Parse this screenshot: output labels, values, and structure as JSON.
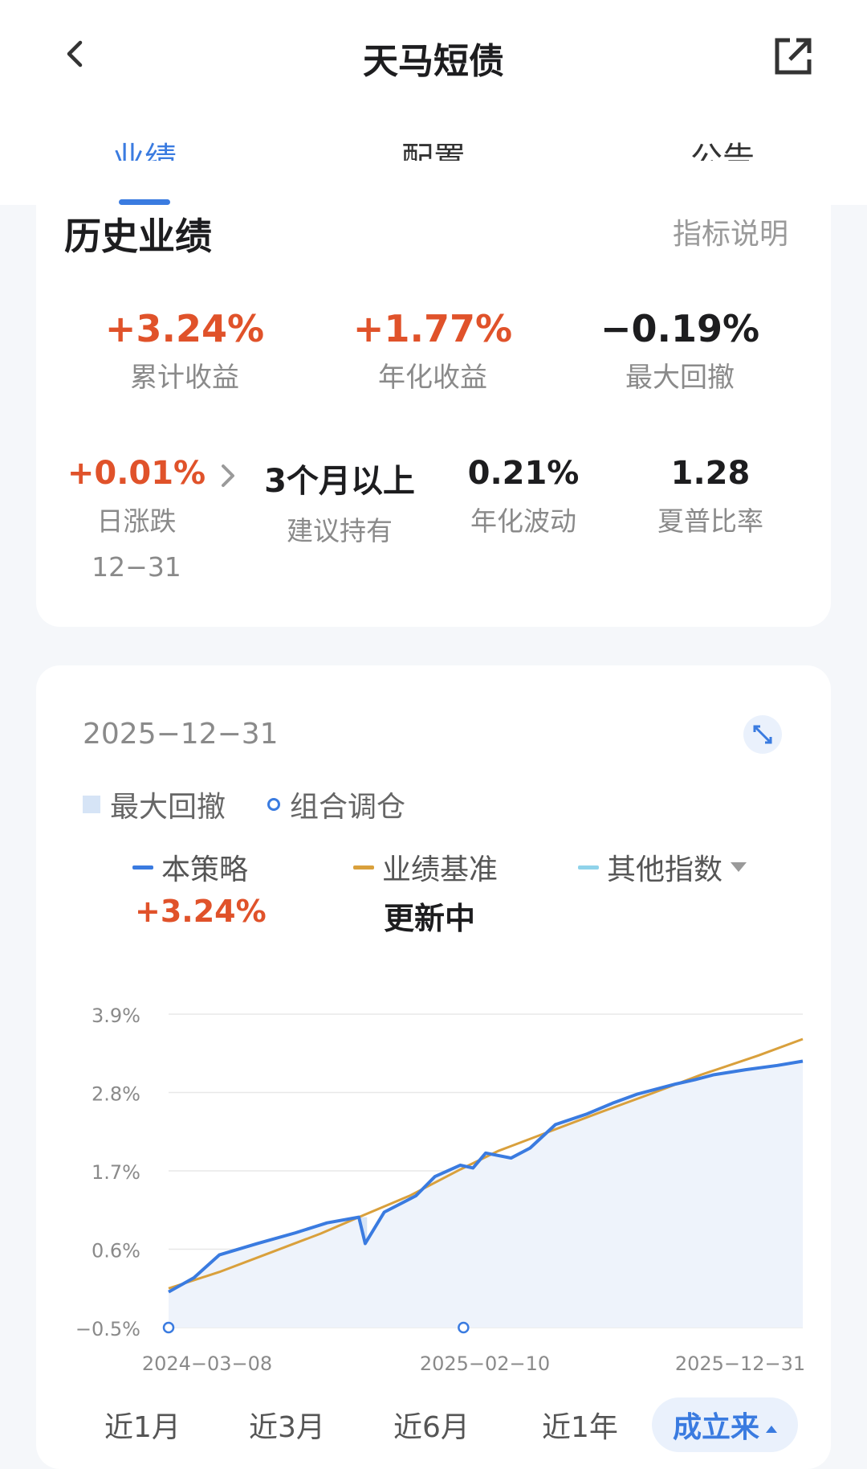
{
  "header": {
    "title": "天马短债"
  },
  "tabs": [
    {
      "label": "业绩",
      "active": true
    },
    {
      "label": "配置",
      "active": false
    },
    {
      "label": "公告",
      "active": false
    }
  ],
  "history": {
    "title": "历史业绩",
    "link": "指标说明",
    "metrics_top": [
      {
        "value": "+3.24%",
        "label": "累计收益",
        "color": "red"
      },
      {
        "value": "+1.77%",
        "label": "年化收益",
        "color": "red"
      },
      {
        "value": "−0.19%",
        "label": "最大回撤",
        "color": "dark"
      }
    ],
    "daily": {
      "value": "+0.01%",
      "label": "日涨跌",
      "date": "12−31"
    },
    "metrics_bottom": [
      {
        "value": "3个月以上",
        "label": "建议持有"
      },
      {
        "value": "0.21%",
        "label": "年化波动"
      },
      {
        "value": "1.28",
        "label": "夏普比率"
      }
    ]
  },
  "chart_panel": {
    "date": "2025−12−31",
    "legend_drawdown": "最大回撤",
    "legend_rebalance": "组合调仓",
    "series_legend": [
      {
        "name": "本策略",
        "color": "#3a7be0",
        "value": "+3.24%"
      },
      {
        "name": "业绩基准",
        "color": "#d9a03c",
        "value": "更新中"
      },
      {
        "name": "其他指数",
        "color": "#8fd3ea",
        "value": ""
      }
    ],
    "range_tabs": [
      {
        "label": "近1月",
        "active": false
      },
      {
        "label": "近3月",
        "active": false
      },
      {
        "label": "近6月",
        "active": false
      },
      {
        "label": "近1年",
        "active": false
      },
      {
        "label": "成立来",
        "active": true
      }
    ]
  },
  "chart_data": {
    "type": "line",
    "y_ticks": [
      "3.9%",
      "2.8%",
      "1.7%",
      "0.6%",
      "−0.5%"
    ],
    "x_ticks": [
      "2024−03−08",
      "2025−02−10",
      "2025−12−31"
    ],
    "ylim": [
      -0.5,
      3.9
    ],
    "grid": true,
    "series": [
      {
        "name": "本策略",
        "values": [
          0.0,
          0.2,
          0.52,
          0.68,
          0.83,
          0.97,
          1.05,
          0.68,
          1.12,
          1.35,
          1.62,
          1.78,
          1.74,
          1.95,
          1.88,
          2.02,
          2.35,
          2.5,
          2.65,
          2.78,
          2.85,
          2.92,
          2.98,
          3.05,
          3.12,
          3.18,
          3.24
        ],
        "x_frac": [
          0,
          0.04,
          0.08,
          0.14,
          0.2,
          0.25,
          0.3,
          0.31,
          0.34,
          0.39,
          0.42,
          0.46,
          0.48,
          0.5,
          0.54,
          0.57,
          0.61,
          0.66,
          0.7,
          0.74,
          0.77,
          0.8,
          0.83,
          0.86,
          0.91,
          0.96,
          1.0
        ]
      },
      {
        "name": "业绩基准",
        "values": [
          0.05,
          0.28,
          0.55,
          0.82,
          1.05,
          1.35,
          1.72,
          1.98,
          2.25,
          2.52,
          2.78,
          3.05,
          3.32,
          3.55
        ],
        "x_frac": [
          0,
          0.08,
          0.16,
          0.24,
          0.3,
          0.38,
          0.46,
          0.52,
          0.6,
          0.68,
          0.76,
          0.84,
          0.93,
          1.0
        ]
      }
    ],
    "rebalance_points_frac": [
      0.0,
      0.465
    ],
    "drawdown_band_frac": [
      0.3,
      0.313
    ]
  }
}
